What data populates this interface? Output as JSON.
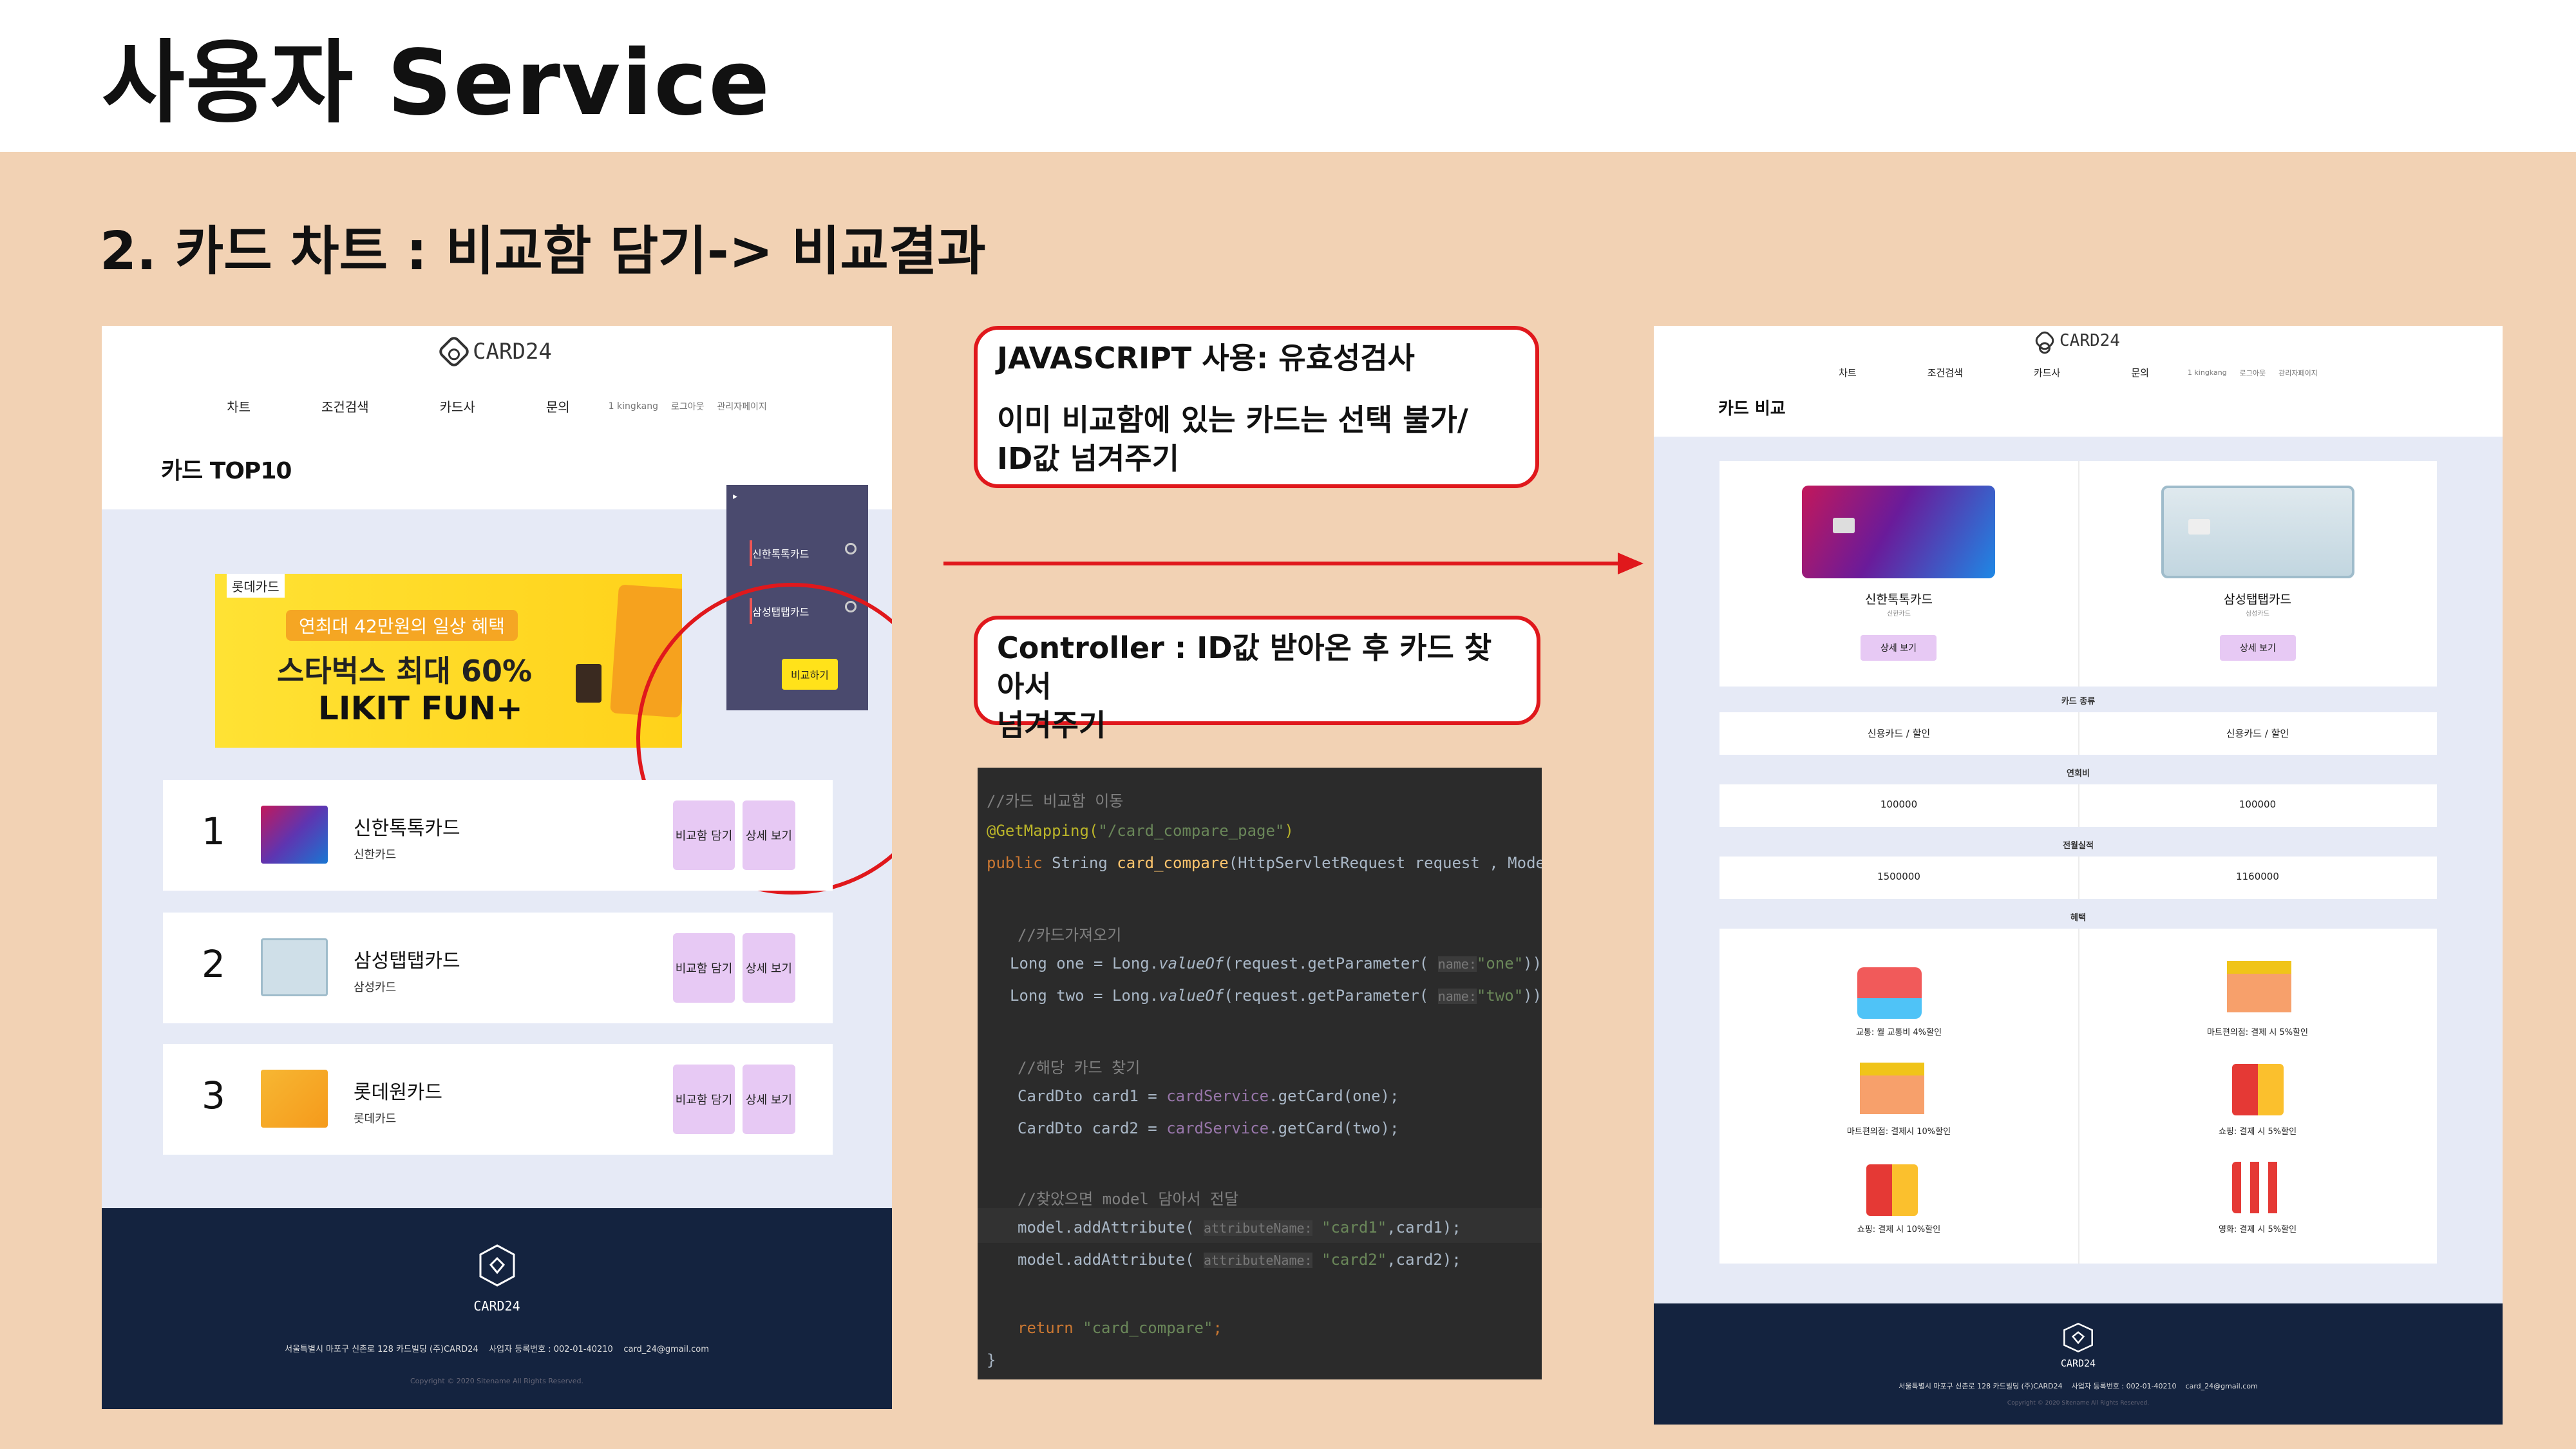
{
  "slide": {
    "title": "사용자 Service",
    "subtitle": "2. 카드 차트 : 비교함 담기-> 비교결과"
  },
  "site": {
    "logo_text": "CARD24",
    "nav": [
      "차트",
      "조건검색",
      "카드사",
      "문의"
    ],
    "user_links": [
      "1 kingkang",
      "로그아웃",
      "관리자페이지"
    ],
    "footer_address": "서울특별시 마포구 신촌로 128 카드빌딩 (주)CARD24",
    "footer_biz": "사업자 등록번호 : 002-01-40210",
    "footer_email": "card_24@gmail.com",
    "footer_copy": "Copyright © 2020 Sitename All Rights Reserved."
  },
  "left_page": {
    "section_title": "카드 TOP10",
    "banner": {
      "tag": "롯데카드",
      "pill": "연최대 42만원의 일상 혜택",
      "headline": "스타벅스 최대 60%",
      "product": "LIKIT FUN+"
    },
    "compare_box": {
      "items": [
        "신한톡톡카드",
        "삼성탭탭카드"
      ],
      "button": "비교하기"
    },
    "cards": [
      {
        "rank": "1",
        "name": "신한톡톡카드",
        "company": "신한카드",
        "btn_compare": "비교함 담기",
        "btn_detail": "상세 보기",
        "color": "#7a3aa8"
      },
      {
        "rank": "2",
        "name": "삼성탭탭카드",
        "company": "삼성카드",
        "btn_compare": "비교함 담기",
        "btn_detail": "상세 보기",
        "color": "#c7d9e3"
      },
      {
        "rank": "3",
        "name": "롯데원카드",
        "company": "롯데카드",
        "btn_compare": "비교함 담기",
        "btn_detail": "상세 보기",
        "color": "#f6a21e"
      }
    ]
  },
  "callouts": {
    "js_line1": "JAVASCRIPT 사용: 유효성검사",
    "js_line2": "이미 비교함에 있는 카드는 선택 불가/",
    "js_line3": "ID값 넘겨주기",
    "ctrl_line1": "Controller : ID값 받아온 후 카드 찾아서",
    "ctrl_line2": "넘겨주기"
  },
  "code": {
    "l1": "//카드 비교함 이동",
    "l2_ann": "@GetMapping(",
    "l2_str": "\"/card_compare_page\"",
    "l2_end": ")",
    "l3_kw": "public",
    "l3_rest": " String ",
    "l3_fn": "card_compare",
    "l3_args": "(HttpServletRequest request , Model model){",
    "l4": "//카드가져오기",
    "l5_a": "Long one = Long.",
    "l5_b": "valueOf",
    "l5_c": "(request.getParameter(",
    "l5_hint": "name:",
    "l5_str": "\"one\"",
    "l5_end": "));",
    "l6_a": "Long two = Long.",
    "l6_b": "valueOf",
    "l6_c": "(request.getParameter(",
    "l6_hint": "name:",
    "l6_str": "\"two\"",
    "l6_end": "));",
    "l7": "//해당 카드 찾기",
    "l8_a": "CardDto card1 = ",
    "l8_b": "cardService",
    "l8_c": ".getCard(one);",
    "l9_a": "CardDto card2 = ",
    "l9_b": "cardService",
    "l9_c": ".getCard(two);",
    "l10": "//찾았으면 model 담아서 전달",
    "l11_a": "model.addAttribute(",
    "l11_hint": "attributeName:",
    "l11_str": "\"card1\"",
    "l11_end": ",card1);",
    "l12_a": "model.addAttribute(",
    "l12_hint": "attributeName:",
    "l12_str": "\"card2\"",
    "l12_end": ",card2);",
    "l13_kw": "return",
    "l13_str": " \"card_compare\"",
    "l13_end": ";",
    "l14": "}"
  },
  "right_page": {
    "section_title": "카드 비교",
    "cards": [
      {
        "name": "신한톡톡카드",
        "sub": "신한카드",
        "detail": "상세 보기",
        "type": "신용카드 / 할인",
        "annual_fee": "100000",
        "prev_perf": "1500000",
        "gradient": "#c2185b"
      },
      {
        "name": "삼성탭탭카드",
        "sub": "삼성카드",
        "detail": "상세 보기",
        "type": "신용카드 / 할인",
        "annual_fee": "100000",
        "prev_perf": "1160000",
        "gradient": "#9fc3d4"
      }
    ],
    "labels": {
      "type": "카드 종류",
      "annual_fee": "연회비",
      "prev_perf": "전월실적",
      "benefit": "혜택"
    },
    "benefits_left": [
      "교통: 월 교통비 4%할인",
      "마트편의점: 결제시 10%할인",
      "쇼핑: 결제 시 10%할인"
    ],
    "benefits_right": [
      "마트편의점: 결제 시 5%할인",
      "쇼핑: 결제 시 5%할인",
      "영화: 결제 시 5%할인"
    ]
  }
}
